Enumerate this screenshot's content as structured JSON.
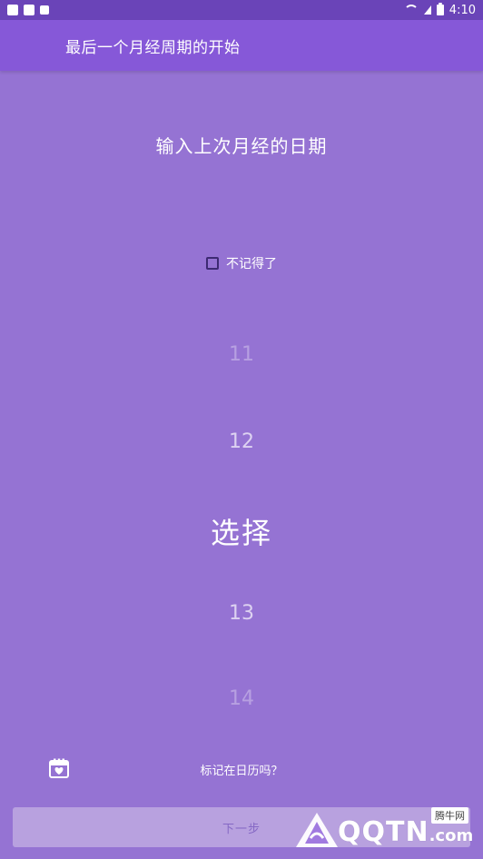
{
  "status_bar": {
    "time": "4:10"
  },
  "app_bar": {
    "title": "最后一个月经周期的开始"
  },
  "prompt": {
    "text": "输入上次月经的日期"
  },
  "forgot": {
    "label": "不记得了",
    "checked": false
  },
  "picker": {
    "items": [
      "11",
      "12",
      "选择",
      "13",
      "14"
    ],
    "selected_index": 2
  },
  "calendar": {
    "icon": "calendar-heart-icon",
    "label": "标记在日历吗？"
  },
  "next_button": {
    "label": "下一步"
  },
  "watermark": {
    "brand": "QQTN",
    "suffix": ".com",
    "badge": "腾牛网"
  },
  "colors": {
    "status_bar": "#6a44b8",
    "app_bar": "#8658d8",
    "background": "#9573d3",
    "button": "#b8a1df"
  }
}
